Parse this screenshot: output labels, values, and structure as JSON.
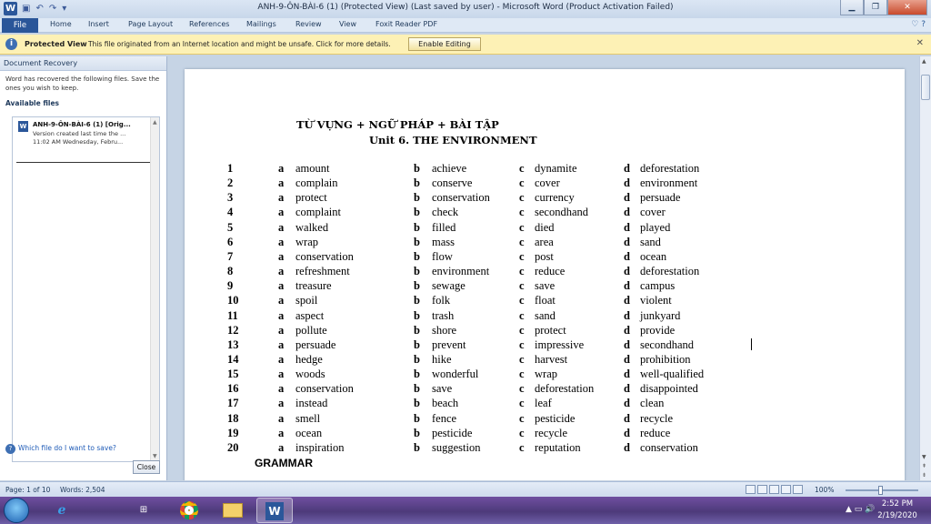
{
  "window": {
    "title": "ANH-9-ÔN-BÀI-6 (1) (Protected View) (Last saved by user)  -  Microsoft Word (Product Activation Failed)",
    "app_icon_letter": "W"
  },
  "ribbon": {
    "file_tab": "File",
    "tabs": [
      "Home",
      "Insert",
      "Page Layout",
      "References",
      "Mailings",
      "Review",
      "View",
      "Foxit Reader PDF"
    ]
  },
  "protected_view": {
    "label": "Protected View",
    "message": "This file originated from an Internet location and might be unsafe. Click for more details.",
    "button": "Enable Editing"
  },
  "recovery": {
    "title": "Document Recovery",
    "description": "Word has recovered the following files.  Save the ones you wish to keep.",
    "available_label": "Available files",
    "file": {
      "name": "ANH-9-ÔN-BÀI-6 (1)  [Orig...",
      "version": "Version created last time the ...",
      "time": "11:02 AM Wednesday, Febru..."
    },
    "help_link": "Which file do I want to save?",
    "close_button": "Close"
  },
  "document": {
    "title": "TỪ VỰNG + NGỮ PHÁP + BÀI TẬP",
    "subtitle": "Unit 6. THE ENVIRONMENT",
    "option_letters": [
      "a",
      "b",
      "c",
      "d"
    ],
    "rows": [
      {
        "n": "1",
        "a": "amount",
        "b": "achieve",
        "c": "dynamite",
        "d": "deforestation"
      },
      {
        "n": "2",
        "a": "complain",
        "b": "conserve",
        "c": "cover",
        "d": "environment"
      },
      {
        "n": "3",
        "a": "protect",
        "b": "conservation",
        "c": "currency",
        "d": "persuade"
      },
      {
        "n": "4",
        "a": "complaint",
        "b": "check",
        "c": "secondhand",
        "d": "cover"
      },
      {
        "n": "5",
        "a": "walked",
        "b": "filled",
        "c": "died",
        "d": "played"
      },
      {
        "n": "6",
        "a": "wrap",
        "b": "mass",
        "c": "area",
        "d": "sand"
      },
      {
        "n": "7",
        "a": "conservation",
        "b": "flow",
        "c": "post",
        "d": "ocean"
      },
      {
        "n": "8",
        "a": "refreshment",
        "b": "environment",
        "c": "reduce",
        "d": "deforestation"
      },
      {
        "n": "9",
        "a": "treasure",
        "b": "sewage",
        "c": "save",
        "d": "campus"
      },
      {
        "n": "10",
        "a": "spoil",
        "b": "folk",
        "c": "float",
        "d": "violent"
      },
      {
        "n": "11",
        "a": "aspect",
        "b": "trash",
        "c": "sand",
        "d": "junkyard"
      },
      {
        "n": "12",
        "a": "pollute",
        "b": "shore",
        "c": "protect",
        "d": "provide"
      },
      {
        "n": "13",
        "a": "persuade",
        "b": "prevent",
        "c": "impressive",
        "d": "secondhand"
      },
      {
        "n": "14",
        "a": "hedge",
        "b": "hike",
        "c": "harvest",
        "d": "prohibition"
      },
      {
        "n": "15",
        "a": "woods",
        "b": "wonderful",
        "c": "wrap",
        "d": "well-qualified"
      },
      {
        "n": "16",
        "a": "conservation",
        "b": "save",
        "c": "deforestation",
        "d": "disappointed"
      },
      {
        "n": "17",
        "a": "instead",
        "b": "beach",
        "c": "leaf",
        "d": "clean"
      },
      {
        "n": "18",
        "a": "smell",
        "b": "fence",
        "c": "pesticide",
        "d": "recycle"
      },
      {
        "n": "19",
        "a": "ocean",
        "b": "pesticide",
        "c": "recycle",
        "d": "reduce"
      },
      {
        "n": "20",
        "a": "inspiration",
        "b": "suggestion",
        "c": "reputation",
        "d": "conservation"
      }
    ],
    "section_heading": "GRAMMAR"
  },
  "status": {
    "page": "Page: 1 of 10",
    "words": "Words: 2,504",
    "zoom": "100%"
  },
  "taskbar": {
    "time": "2:52 PM",
    "date": "2/19/2020"
  }
}
